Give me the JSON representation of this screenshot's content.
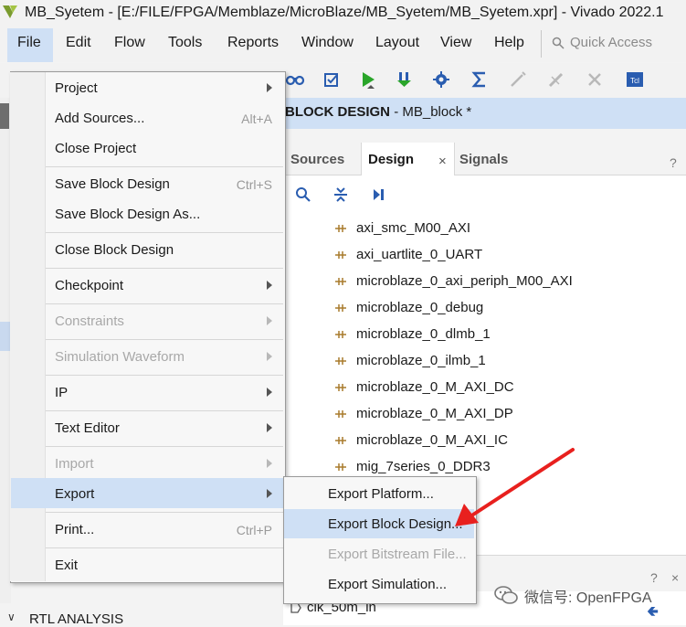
{
  "window": {
    "title": "MB_Syetem - [E:/FILE/FPGA/Memblaze/MicroBlaze/MB_Syetem/MB_Syetem.xpr] - Vivado 2022.1"
  },
  "menubar": {
    "items": [
      "File",
      "Edit",
      "Flow",
      "Tools",
      "Reports",
      "Window",
      "Layout",
      "View",
      "Help"
    ],
    "quick_access_placeholder": "Quick Access"
  },
  "block_design": {
    "label": "BLOCK DESIGN",
    "name": "- MB_block *"
  },
  "tabs": {
    "sources": "Sources",
    "design": "Design",
    "signals": "Signals",
    "close": "×",
    "help": "?"
  },
  "tree_items": [
    "axi_smc_M00_AXI",
    "axi_uartlite_0_UART",
    "microblaze_0_axi_periph_M00_AXI",
    "microblaze_0_debug",
    "microblaze_0_dlmb_1",
    "microblaze_0_ilmb_1",
    "microblaze_0_M_AXI_DC",
    "microblaze_0_M_AXI_DP",
    "microblaze_0_M_AXI_IC",
    "mig_7series_0_DDR3"
  ],
  "lower_pane": {
    "help": "?",
    "close": "×",
    "port_label": "clk_50m_in"
  },
  "left_panel": {
    "rtl_analysis": "RTL ANALYSIS",
    "chevron": "∨"
  },
  "file_menu": {
    "project": "Project",
    "add_sources": "Add Sources...",
    "add_sources_shortcut": "Alt+A",
    "close_project": "Close Project",
    "save_bd": "Save Block Design",
    "save_bd_shortcut": "Ctrl+S",
    "save_bd_as": "Save Block Design As...",
    "close_bd": "Close Block Design",
    "checkpoint": "Checkpoint",
    "constraints": "Constraints",
    "sim_waveform": "Simulation Waveform",
    "ip": "IP",
    "text_editor": "Text Editor",
    "import": "Import",
    "export": "Export",
    "print": "Print...",
    "print_shortcut": "Ctrl+P",
    "exit": "Exit"
  },
  "export_menu": {
    "export_platform": "Export Platform...",
    "export_block_design": "Export Block Design...",
    "export_bitstream": "Export Bitstream File...",
    "export_simulation": "Export Simulation..."
  },
  "watermark": {
    "text": "微信号: OpenFPGA"
  },
  "colors": {
    "highlight": "#cfe0f5",
    "annotation_arrow": "#e8201e",
    "run_green": "#2aa52a",
    "icon_blue": "#2a5db0"
  }
}
